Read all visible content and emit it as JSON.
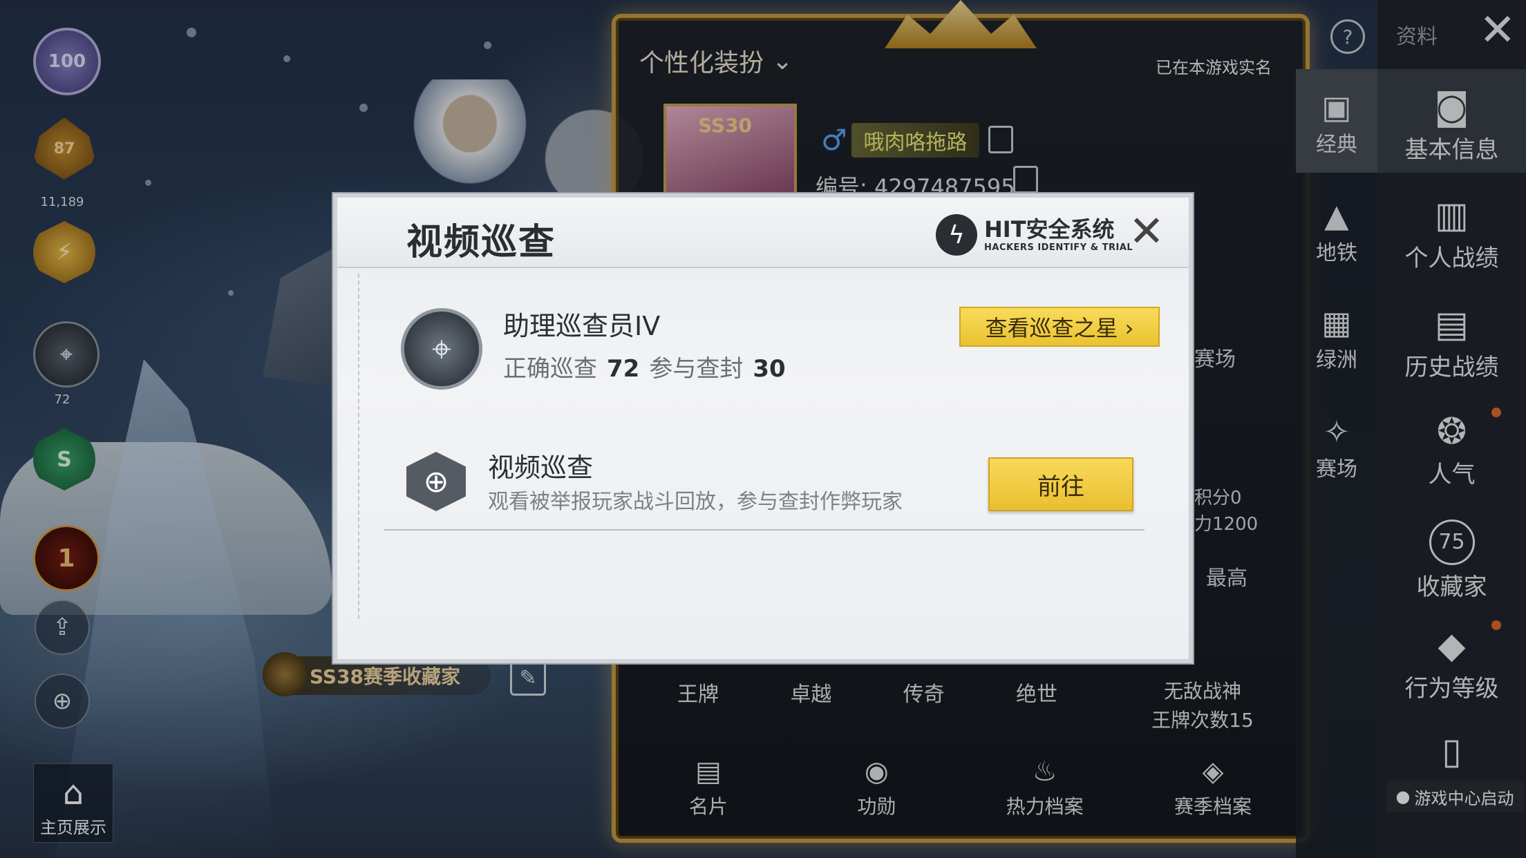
{
  "left": {
    "level_badge": "100",
    "tier_badge": "87",
    "tier_points": "11,189",
    "weapon_level": "72",
    "season_badge": "S",
    "rank_badge": "1",
    "home_label": "主页展示"
  },
  "collector_banner": "SS38赛季收藏家",
  "profile": {
    "dress_up": "个性化装扮",
    "realname_note": "已在本游戏实名",
    "season_frame": "SS30",
    "gender_symbol": "♂",
    "nickname": "哦肉咯拖路",
    "id_label": "编号: 4297487595",
    "peek": {
      "arena": "赛场",
      "points_a": "积分0",
      "points_b": "力1200",
      "highest": "最高"
    },
    "ranks": [
      "王牌",
      "卓越",
      "传奇",
      "绝世"
    ],
    "invincible_a": "无敌战神",
    "invincible_b": "王牌次数15",
    "tabs": [
      {
        "label": "名片",
        "icon": "card-icon"
      },
      {
        "label": "功勋",
        "icon": "medal-icon"
      },
      {
        "label": "热力档案",
        "icon": "flame-icon"
      },
      {
        "label": "赛季档案",
        "icon": "season-icon"
      }
    ]
  },
  "topbar": {
    "help": "?",
    "info": "资料",
    "close": "✕"
  },
  "strip": [
    {
      "label": "经典",
      "icon": "classic-icon"
    },
    {
      "label": "地铁",
      "icon": "metro-icon"
    },
    {
      "label": "绿洲",
      "icon": "oasis-icon"
    },
    {
      "label": "赛场",
      "icon": "arena-icon"
    }
  ],
  "nav": [
    {
      "label": "基本信息",
      "icon": "profile-icon"
    },
    {
      "label": "个人战绩",
      "icon": "stats-icon"
    },
    {
      "label": "历史战绩",
      "icon": "history-icon"
    },
    {
      "label": "人气",
      "icon": "popularity-icon"
    },
    {
      "label": "收藏家",
      "icon": "collector-icon"
    },
    {
      "label": "行为等级",
      "icon": "behavior-icon"
    }
  ],
  "collector_level": "75",
  "gamecenter": "游戏中心启动",
  "modal": {
    "title": "视频巡查",
    "logo_big": "HIT安全系统",
    "logo_small": "HACKERS IDENTIFY & TRIAL",
    "close": "✕",
    "rank_name": "助理巡查员IV",
    "stats_label_a": "正确巡查",
    "stats_value_a": "72",
    "stats_label_b": "参与查封",
    "stats_value_b": "30",
    "star_button": "查看巡查之星 ›",
    "video_title": "视频巡查",
    "video_desc": "观看被举报玩家战斗回放，参与查封作弊玩家",
    "go_button": "前往"
  }
}
